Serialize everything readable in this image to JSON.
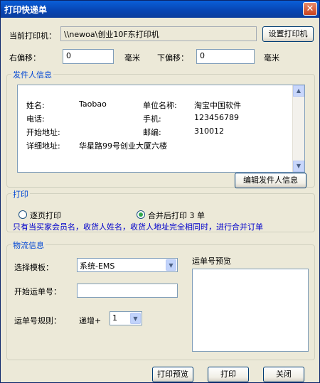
{
  "window": {
    "title": "打印快递单",
    "close_glyph": "✕"
  },
  "printer": {
    "label": "当前打印机：",
    "value": "\\\\newoa\\创业10F东打印机",
    "set_button": "设置打印机"
  },
  "offsets": {
    "right_label": "右偏移：",
    "right_value": "0",
    "right_unit": "毫米",
    "down_label": "下偏移：",
    "down_value": "0",
    "down_unit": "毫米"
  },
  "sender": {
    "group_label": "发件人信息",
    "name_label": "姓名:",
    "name_value": "Taobao",
    "company_label": "单位名称:",
    "company_value": "淘宝中国软件",
    "phone_label": "电话:",
    "phone_value": "",
    "mobile_label": "手机:",
    "mobile_value": "123456789",
    "start_addr_label": "开始地址:",
    "start_addr_value": "",
    "zip_label": "邮编:",
    "zip_value": "310012",
    "detail_addr_label": "详细地址:",
    "detail_addr_value": "华星路99号创业大厦六楼",
    "edit_button": "编辑发件人信息"
  },
  "print": {
    "group_label": "打印",
    "option_single": "逐页打印",
    "option_merge": "合并后打印 3 单",
    "selected": "option_merge",
    "note": "只有当买家会员名，收货人姓名，收货人地址完全相同时，进行合并订单"
  },
  "logistics": {
    "group_label": "物流信息",
    "template_label": "选择模板：",
    "template_value": "系统-EMS",
    "start_no_label": "开始运单号：",
    "start_no_value": "",
    "rule_label": "运单号规则：",
    "increment_label": "递增+",
    "increment_value": "1",
    "preview_label": "运单号预览"
  },
  "buttons": {
    "preview": "打印预览",
    "print": "打印",
    "close": "关闭"
  }
}
